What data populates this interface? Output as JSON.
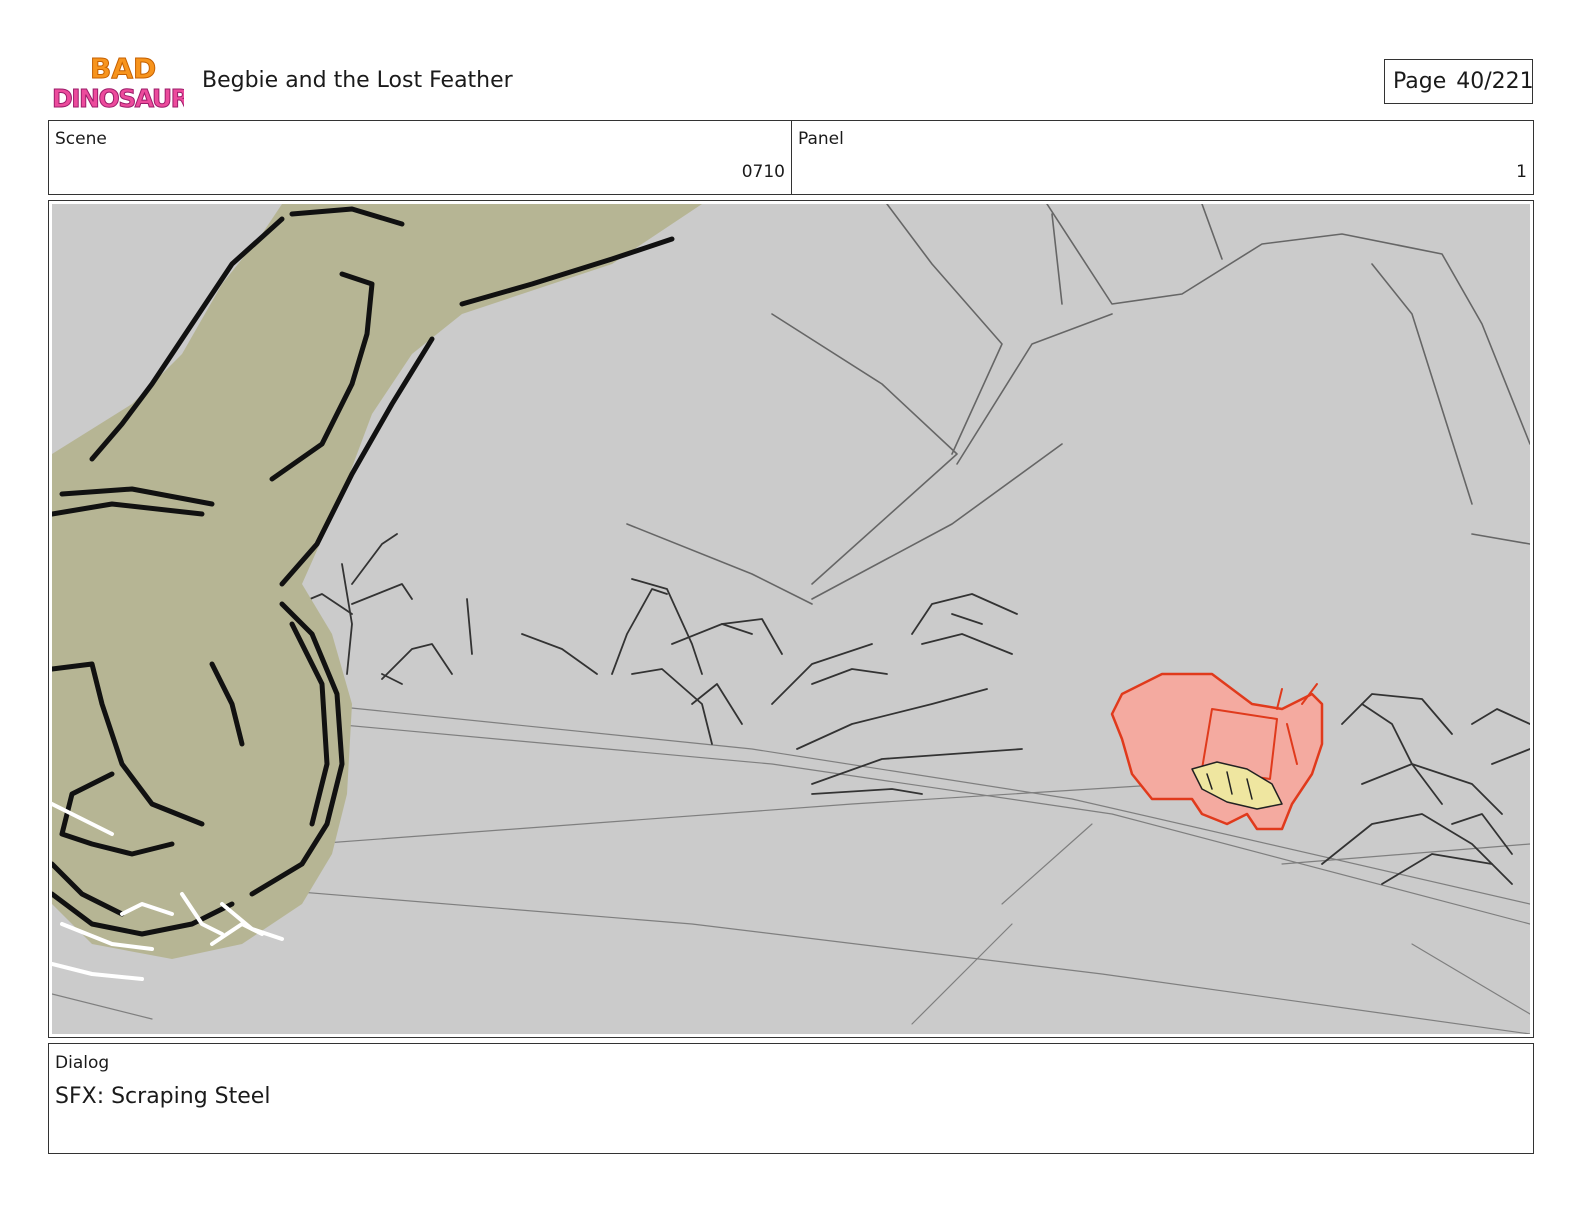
{
  "header": {
    "logo": {
      "line1": "BAD",
      "line2": "DINOSAURS"
    },
    "title": "Begbie and the Lost Feather",
    "page_label": "Page",
    "page_value": "40/221"
  },
  "info": {
    "scene_label": "Scene",
    "scene_value": "0710",
    "panel_label": "Panel",
    "panel_value": "1"
  },
  "dialog": {
    "label": "Dialog",
    "text": "SFX: Scraping Steel"
  },
  "colors": {
    "panel_bg": "#cbcbcb",
    "dino_skin": "#b6b594",
    "creature": "#f4aaa0",
    "creature_line": "#e03a1c"
  }
}
